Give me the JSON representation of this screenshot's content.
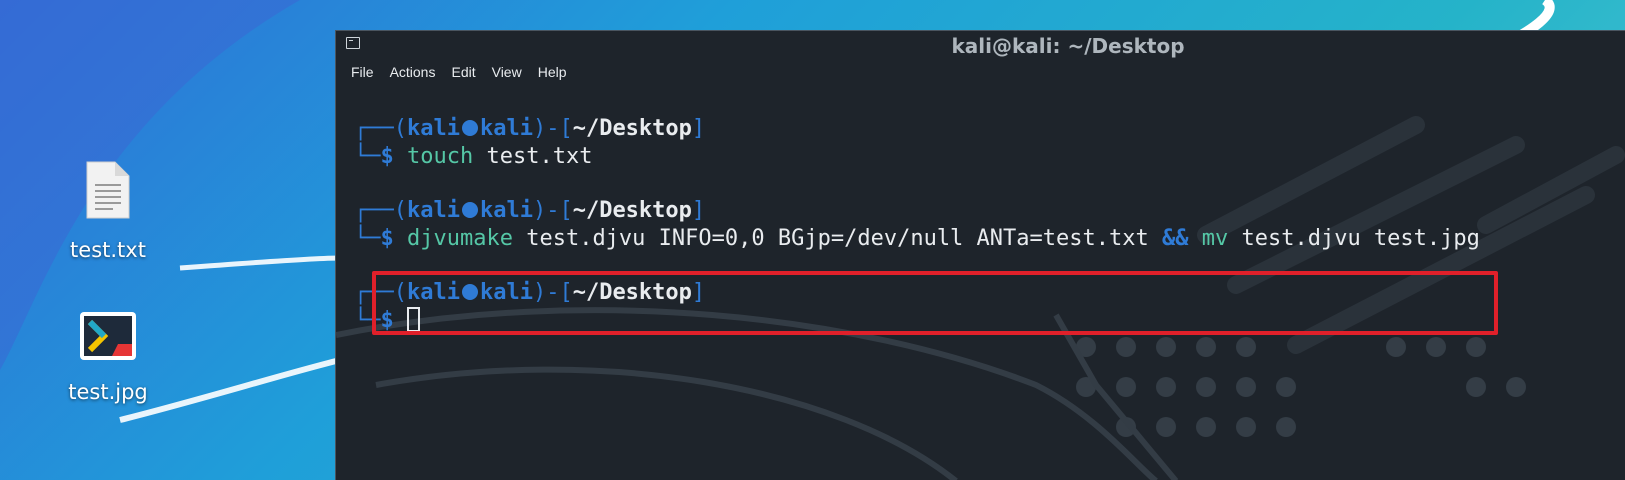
{
  "window": {
    "title": "kali@kali: ~/Desktop",
    "menu": [
      "File",
      "Actions",
      "Edit",
      "View",
      "Help"
    ]
  },
  "desktop": {
    "icons": [
      {
        "label": "test.txt",
        "icon": "text-file-icon"
      },
      {
        "label": "test.jpg",
        "icon": "terminal-app-icon"
      }
    ]
  },
  "prompt": {
    "open": "┌──(",
    "user": "kali",
    "host": "kali",
    "close": ")-[",
    "path": "~/Desktop",
    "end": "]",
    "corner": "└─",
    "dollar": "$"
  },
  "commands": [
    {
      "cmd": "touch",
      "args": " test.txt"
    },
    {
      "cmd": "djvumake",
      "args": " test.djvu INFO=0,0 BGjp=/dev/null ANTa=test.txt ",
      "op": "&&",
      "cmd2": " mv",
      "args2": " test.djvu test.jpg"
    }
  ],
  "colors": {
    "prompt_blue": "#2f7bd6",
    "command_green": "#55c7a6",
    "highlight_red": "#e0202a",
    "terminal_bg": "#1e242b"
  }
}
